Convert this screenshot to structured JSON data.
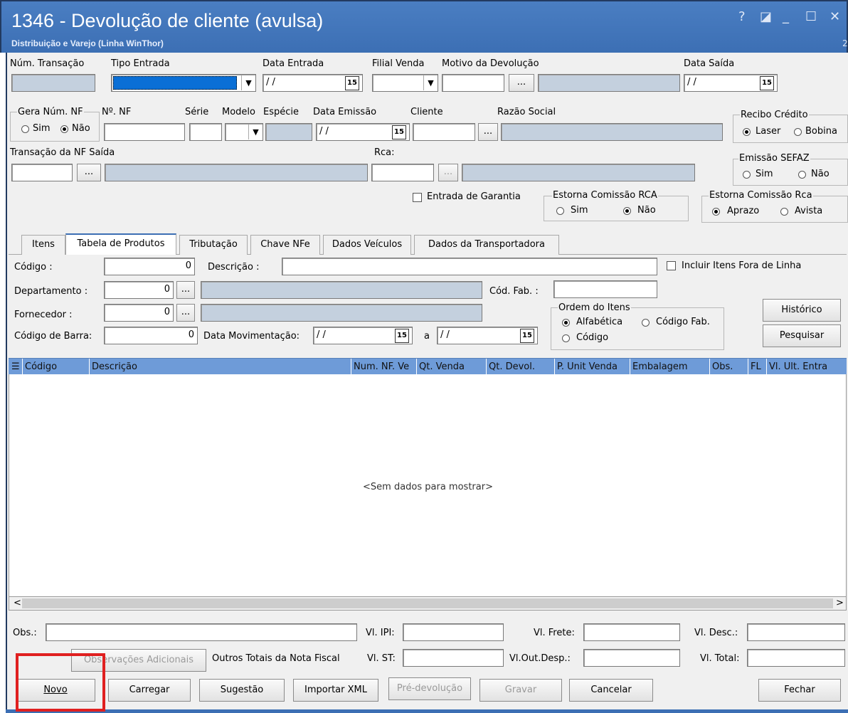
{
  "window": {
    "title": "1346 - Devolução de cliente (avulsa)",
    "subtitle": "Distribuição e Varejo (Linha WinThor)",
    "help_glyph": "?",
    "restore_glyph": "◪",
    "minimize_glyph": "_",
    "maximize_glyph": "☐",
    "close_glyph": "✕",
    "edge_text": "2"
  },
  "header": {
    "num_transacao_label": "Núm. Transação",
    "tipo_entrada_label": "Tipo Entrada",
    "data_entrada_label": "Data Entrada",
    "data_entrada_value": "/ /",
    "filial_venda_label": "Filial Venda",
    "motivo_devolucao_label": "Motivo da Devolução",
    "data_saida_label": "Data Saída",
    "data_saida_value": "/ /",
    "gera_num_nf_label": "Gera Núm. NF",
    "gera_sim": "Sim",
    "gera_nao": "Não",
    "num_nf_label": "Nº. NF",
    "serie_label": "Série",
    "modelo_label": "Modelo",
    "especie_label": "Espécie",
    "data_emissao_label": "Data Emissão",
    "data_emissao_value": "/ /",
    "cliente_label": "Cliente",
    "razao_social_label": "Razão Social",
    "recibo_credito_label": "Recibo Crédito",
    "recibo_laser": "Laser",
    "recibo_bobina": "Bobina",
    "transacao_nf_saida_label": "Transação da NF Saída",
    "rca_label": "Rca:",
    "emissao_sefaz_label": "Emissão SEFAZ",
    "sefaz_sim": "Sim",
    "sefaz_nao": "Não",
    "entrada_garantia_label": "Entrada de Garantia",
    "estorna_rca_label": "Estorna Comissão RCA",
    "estorna_rca_sim": "Sim",
    "estorna_rca_nao": "Não",
    "estorna_rca2_label": "Estorna Comissão Rca",
    "estorna_aprazo": "Aprazo",
    "estorna_avista": "Avista",
    "ellipsis": "...",
    "calendar_glyph": "15",
    "dropdown_glyph": "▼"
  },
  "tabs": [
    "Itens",
    "Tabela de Produtos",
    "Tributação",
    "Chave NFe",
    "Dados Veículos",
    "Dados da Transportadora"
  ],
  "filters": {
    "codigo_label": "Código :",
    "codigo_value": "0",
    "descricao_label": "Descrição :",
    "incluir_fora_linha_label": "Incluir Itens Fora de Linha",
    "departamento_label": "Departamento :",
    "departamento_value": "0",
    "cod_fab_label": "Cód. Fab. :",
    "fornecedor_label": "Fornecedor :",
    "fornecedor_value": "0",
    "codigo_barra_label": "Código de Barra:",
    "codigo_barra_value": "0",
    "data_mov_label": "Data Movimentação:",
    "data_mov_from": "/ /",
    "data_mov_sep": "a",
    "data_mov_to": "/ /",
    "ordem_label": "Ordem do Itens",
    "ordem_alfabetica": "Alfabética",
    "ordem_codigo_fab": "Código Fab.",
    "ordem_codigo": "Código",
    "historico_button": "Histórico",
    "pesquisar_button": "Pesquisar"
  },
  "grid": {
    "columns": [
      "Código",
      "Descrição",
      "Num. NF. Ve",
      "Qt. Venda",
      "Qt. Devol.",
      "P. Unit Venda",
      "Embalagem",
      "Obs.",
      "FL",
      "Vl. Ult. Entra"
    ],
    "empty_text": "<Sem dados para mostrar>",
    "scroll_left": "<",
    "scroll_right": ">"
  },
  "footer": {
    "obs_label": "Obs.:",
    "vl_ipi_label": "Vl. IPI:",
    "vl_frete_label": "Vl. Frete:",
    "vl_desc_label": "Vl. Desc.:",
    "obs_adicionais_button": "Observações Adicionais",
    "outros_totais_label": "Outros Totais da Nota Fiscal",
    "vl_st_label": "Vl. ST:",
    "vl_out_desp_label": "Vl.Out.Desp.:",
    "vl_total_label": "Vl. Total:"
  },
  "actions": {
    "novo": "Novo",
    "carregar": "Carregar",
    "sugestao": "Sugestão",
    "importar_xml": "Importar XML",
    "pre_devolucao": "Pré-devolução",
    "gravar": "Gravar",
    "cancelar": "Cancelar",
    "fechar": "Fechar"
  },
  "colors": {
    "title_bar": "#3c6fb4",
    "grid_header": "#6e9bd8",
    "readonly_field": "#c4d0de",
    "highlight_box": "#e02020"
  }
}
